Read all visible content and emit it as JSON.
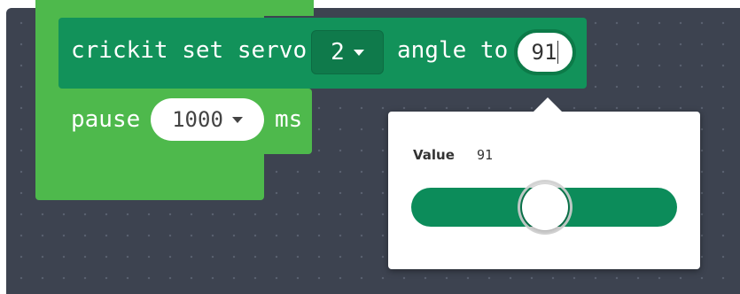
{
  "servo_block": {
    "label": "crickit set servo",
    "servo_value": "2",
    "angle_label": "angle to",
    "angle_value": "91"
  },
  "pause_block": {
    "label": "pause",
    "duration_value": "1000",
    "unit_label": "ms"
  },
  "slider_popup": {
    "value_label": "Value",
    "value": "91",
    "slider_fraction": 0.51
  },
  "colors": {
    "workspace_bg": "#3d4350",
    "loop_green": "#4eb94c",
    "servo_green": "#12925a",
    "slider_track": "#0c8c5a"
  },
  "icons": {
    "dropdown": "chevron-down-icon",
    "pause_dropdown": "chevron-down-icon"
  }
}
